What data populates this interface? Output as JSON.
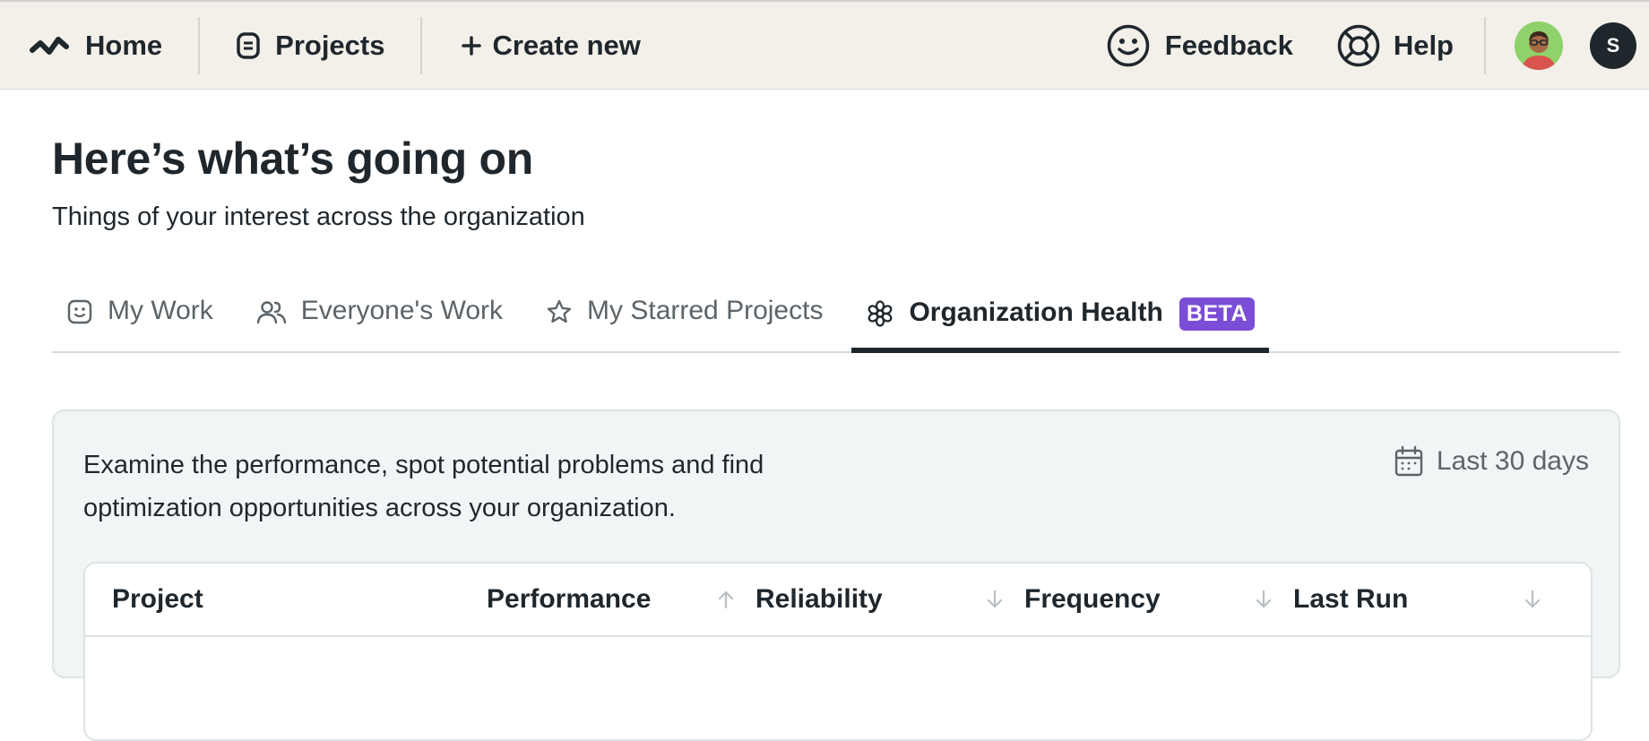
{
  "topbar": {
    "home_label": "Home",
    "projects_label": "Projects",
    "create_label": "Create new",
    "feedback_label": "Feedback",
    "help_label": "Help",
    "user_initial": "S"
  },
  "header": {
    "title": "Here’s what’s going on",
    "subtitle": "Things of your interest across the organization"
  },
  "tabs": [
    {
      "label": "My Work",
      "icon": "smile-square-icon"
    },
    {
      "label": "Everyone's Work",
      "icon": "users-icon"
    },
    {
      "label": "My Starred Projects",
      "icon": "star-icon"
    },
    {
      "label": "Organization Health",
      "icon": "flower-icon",
      "badge": "BETA",
      "active": true
    }
  ],
  "panel": {
    "description": "Examine the performance, spot potential problems and find optimization opportunities across your organization.",
    "date_range": "Last 30 days"
  },
  "table": {
    "columns": [
      {
        "label": "Project"
      },
      {
        "label": "Performance",
        "sort": "asc"
      },
      {
        "label": "Reliability",
        "sort": "desc"
      },
      {
        "label": "Frequency",
        "sort": "desc"
      },
      {
        "label": "Last Run",
        "sort": "desc"
      }
    ]
  },
  "colors": {
    "topbar_bg": "#f3f0ea",
    "text": "#1f272d",
    "muted": "#5c6469",
    "badge": "#7c4dd6",
    "panel_bg": "#f2f5f6"
  }
}
